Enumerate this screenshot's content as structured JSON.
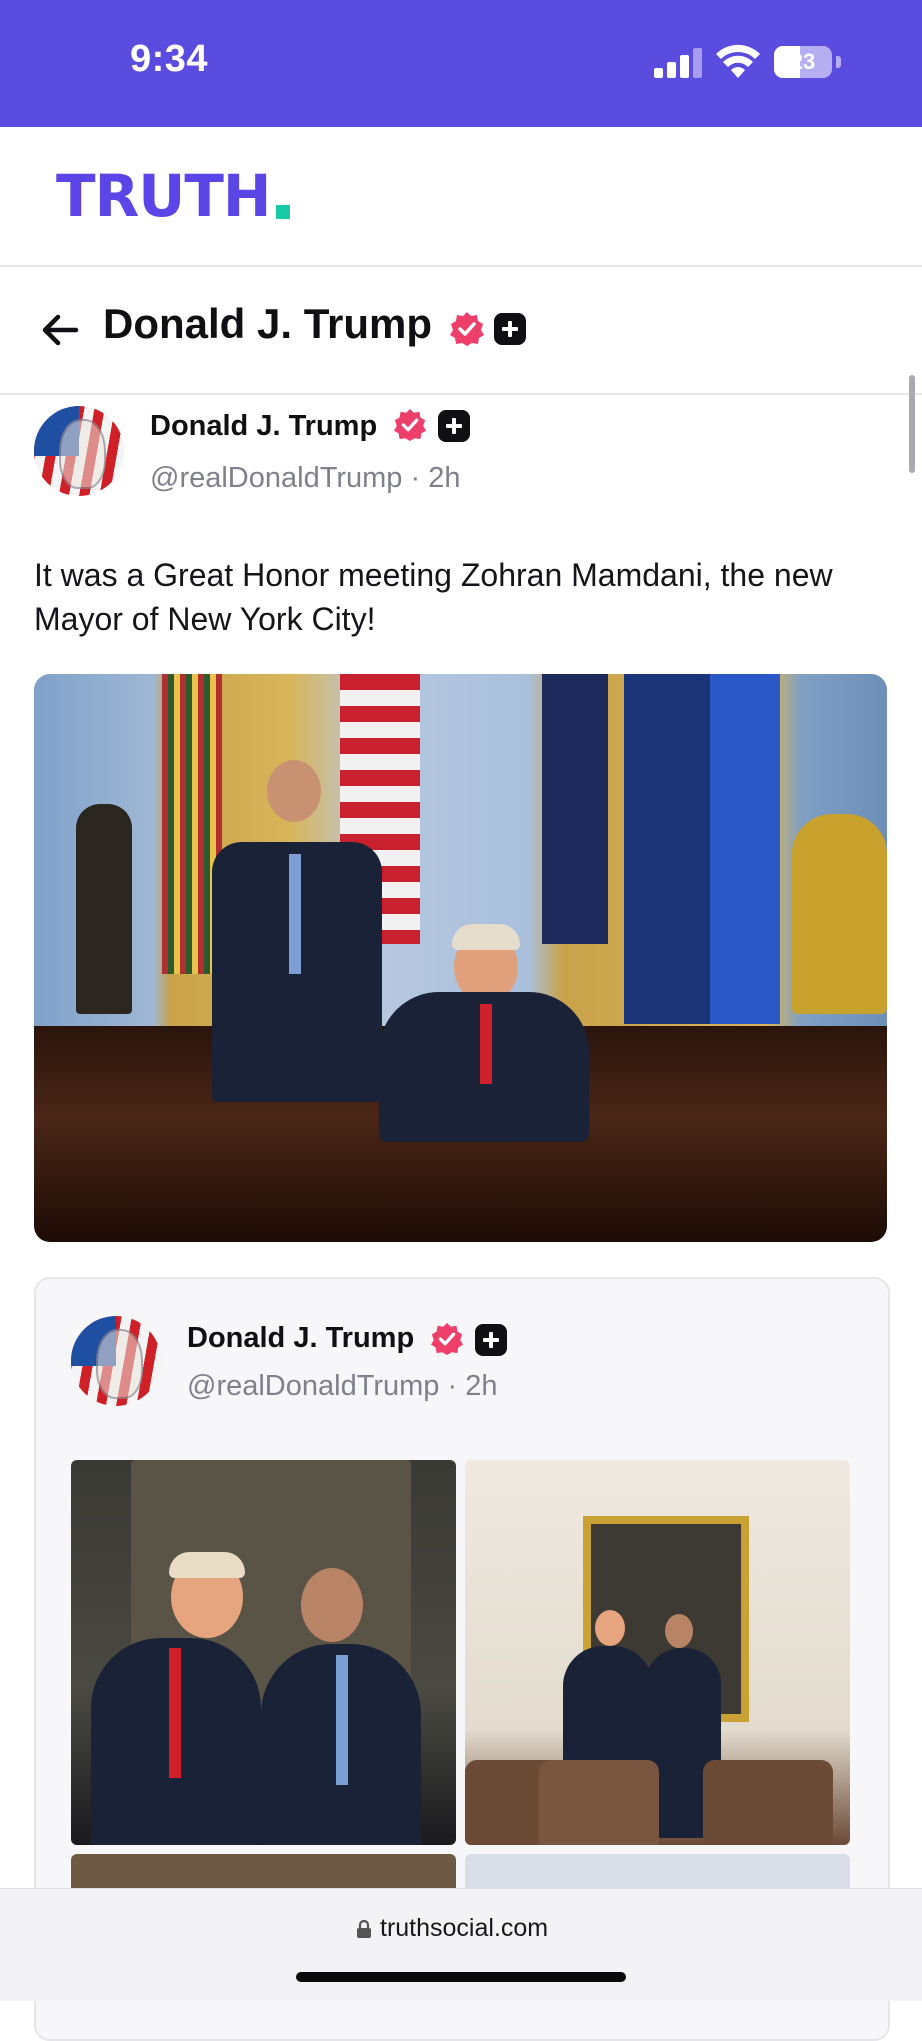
{
  "status_bar": {
    "time": "9:34",
    "battery_level": "23",
    "background_color": "#5b4ce0",
    "icons": [
      "cellular-signal-icon",
      "wifi-icon",
      "battery-icon"
    ]
  },
  "header": {
    "logo_text": "TRUTH",
    "logo_color": "#5b45e6",
    "logo_dot_color": "#19c9a7"
  },
  "profile_bar": {
    "title": "Donald J. Trump",
    "icons": [
      "back-arrow-icon",
      "verified-badge-icon",
      "truth-plus-badge-icon"
    ]
  },
  "post": {
    "author_name": "Donald J. Trump",
    "handle": "@realDonaldTrump",
    "separator": "·",
    "time_ago": "2h",
    "text": "It was a Great Honor meeting Zohran Mamdani, the new Mayor of New York City!",
    "media": [
      {
        "alt": "Oval office photo"
      }
    ]
  },
  "quoted_post": {
    "author_name": "Donald J. Trump",
    "handle": "@realDonaldTrump",
    "separator": "·",
    "time_ago": "2h",
    "media_count": 4
  },
  "browser": {
    "url": "truthsocial.com",
    "icons": [
      "lock-icon"
    ]
  },
  "colors": {
    "verified": "#ee3f6b",
    "text": "#0f0f14",
    "muted": "#80808c"
  }
}
